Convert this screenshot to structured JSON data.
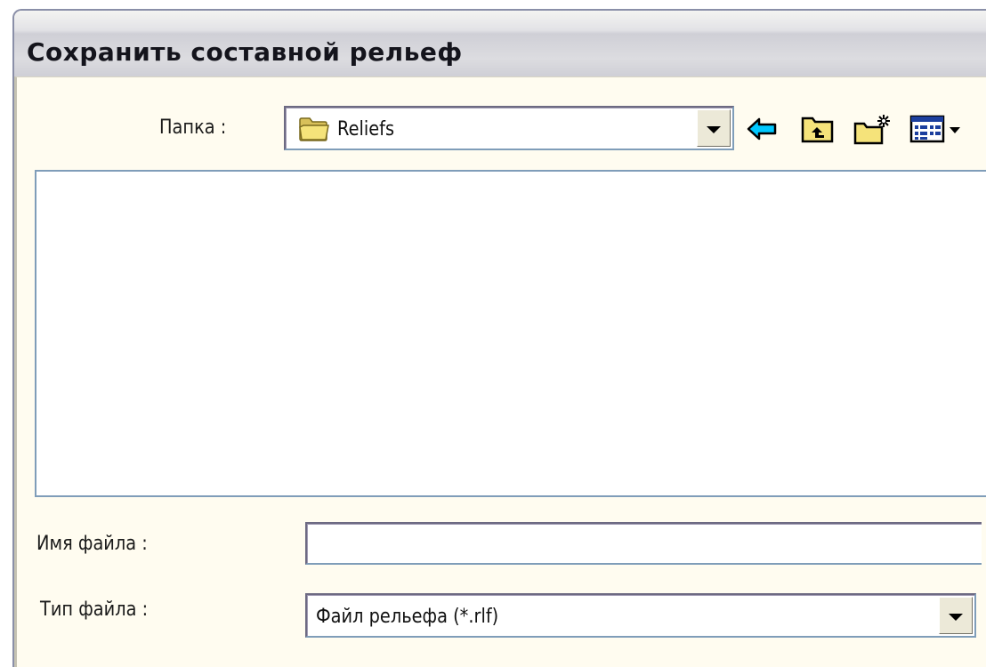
{
  "dialog": {
    "title": "Сохранить составной рельеф"
  },
  "folder": {
    "label": "Папка :",
    "value": "Reliefs",
    "icon": "folder-icon"
  },
  "toolbar": {
    "back_icon": "back-arrow-icon",
    "up_icon": "up-one-level-icon",
    "new_folder_icon": "new-folder-icon",
    "view_menu_icon": "view-menu-icon"
  },
  "file_list": {
    "items": []
  },
  "file_name": {
    "label": "Имя файла :",
    "value": ""
  },
  "file_type": {
    "label": "Тип файла :",
    "value": "Файл рельефа (*.rlf)"
  },
  "colors": {
    "client_background": "#fffcf0",
    "field_border": "#7f9db9",
    "back_arrow": "#00c8ff",
    "folder_yellow": "#f5e37a"
  }
}
